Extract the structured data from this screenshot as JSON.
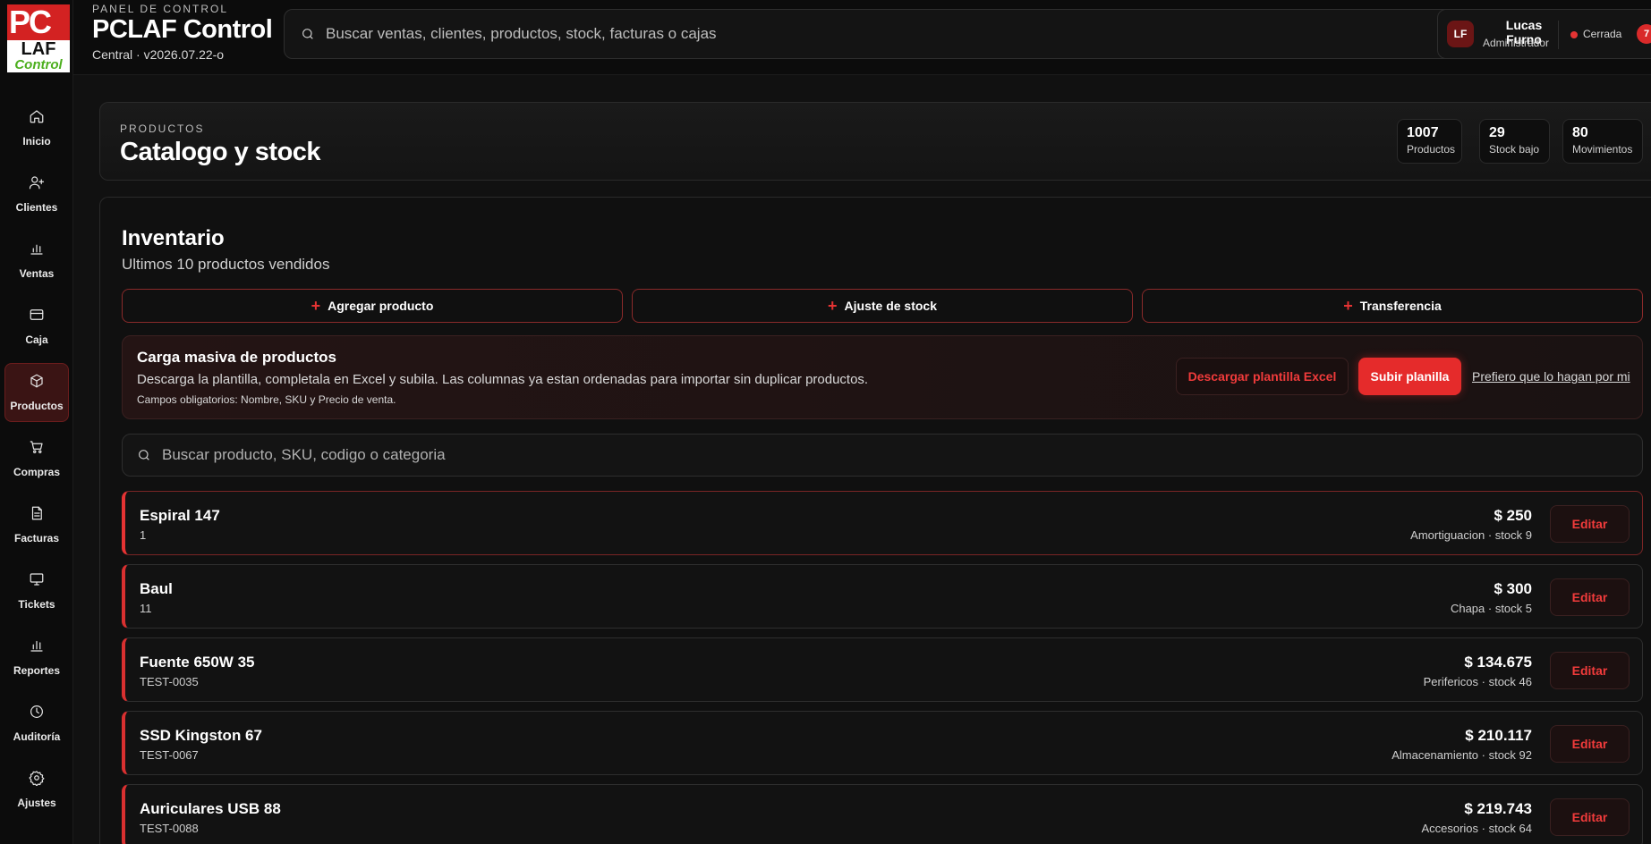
{
  "logo": {
    "pc": "PC",
    "laf": "LAF",
    "control": "Control"
  },
  "brand": {
    "kicker": "PANEL DE CONTROL",
    "title": "PCLAF Control",
    "subtitle": "Central · v2026.07.22-o"
  },
  "search": {
    "placeholder": "Buscar ventas, clientes, productos, stock, facturas o cajas"
  },
  "user": {
    "initials": "LF",
    "name": "Lucas Furno",
    "role": "Administrador",
    "status": "Cerrada",
    "notifications": "7"
  },
  "nav": [
    {
      "label": "Inicio",
      "icon": "home-icon"
    },
    {
      "label": "Clientes",
      "icon": "user-plus-icon"
    },
    {
      "label": "Ventas",
      "icon": "bar-chart-icon"
    },
    {
      "label": "Caja",
      "icon": "wallet-icon"
    },
    {
      "label": "Productos",
      "icon": "box-icon",
      "active": true
    },
    {
      "label": "Compras",
      "icon": "cart-icon"
    },
    {
      "label": "Facturas",
      "icon": "document-icon"
    },
    {
      "label": "Tickets",
      "icon": "monitor-icon"
    },
    {
      "label": "Reportes",
      "icon": "bar-chart-icon"
    },
    {
      "label": "Auditoría",
      "icon": "clock-icon"
    },
    {
      "label": "Ajustes",
      "icon": "gear-icon"
    }
  ],
  "header": {
    "kicker": "PRODUCTOS",
    "title": "Catalogo y stock",
    "stats": [
      {
        "value": "1007",
        "label": "Productos"
      },
      {
        "value": "29",
        "label": "Stock bajo"
      },
      {
        "value": "80",
        "label": "Movimientos"
      }
    ]
  },
  "inventory": {
    "title": "Inventario",
    "subtitle": "Ultimos 10 productos vendidos",
    "actions": [
      "Agregar producto",
      "Ajuste de stock",
      "Transferencia"
    ],
    "bulk": {
      "title": "Carga masiva de productos",
      "description": "Descarga la plantilla, completala en Excel y subila. Las columnas ya estan ordenadas para importar sin duplicar productos.",
      "note": "Campos obligatorios: Nombre, SKU y Precio de venta.",
      "download_label": "Descargar plantilla Excel",
      "upload_label": "Subir planilla",
      "help_label": "Prefiero que lo hagan por mi"
    },
    "search_placeholder": "Buscar producto, SKU, codigo o categoria",
    "edit_label": "Editar",
    "products": [
      {
        "name": "Espiral 147",
        "sku": "1",
        "price": "$ 250",
        "meta": "Amortiguacion · stock 9"
      },
      {
        "name": "Baul",
        "sku": "11",
        "price": "$ 300",
        "meta": "Chapa · stock 5"
      },
      {
        "name": "Fuente 650W 35",
        "sku": "TEST-0035",
        "price": "$ 134.675",
        "meta": "Perifericos · stock 46"
      },
      {
        "name": "SSD Kingston 67",
        "sku": "TEST-0067",
        "price": "$ 210.117",
        "meta": "Almacenamiento · stock 92"
      },
      {
        "name": "Auriculares USB 88",
        "sku": "TEST-0088",
        "price": "$ 219.743",
        "meta": "Accesorios · stock 64"
      }
    ]
  },
  "colors": {
    "accent": "#e52b2b",
    "background": "#111111",
    "status_dot": "#e53333"
  }
}
